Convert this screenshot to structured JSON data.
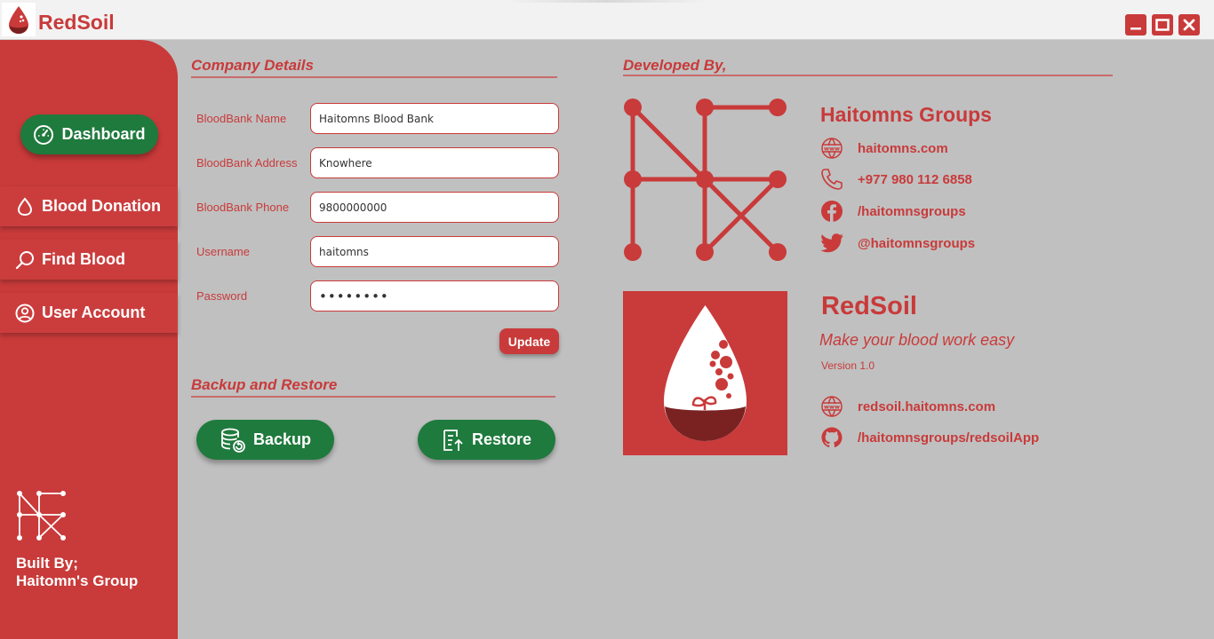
{
  "window": {
    "title": "RedSoil",
    "icon": "blood-drop-icon"
  },
  "sidebar": {
    "dashboard_label": "Dashboard",
    "items": [
      {
        "label": "Blood Donation",
        "icon": "drop-icon"
      },
      {
        "label": "Find Blood",
        "icon": "search-icon"
      },
      {
        "label": "User Account",
        "icon": "user-icon"
      }
    ],
    "built_by_line1": "Built By;",
    "built_by_line2": "Haitomn's Group"
  },
  "company": {
    "title": "Company Details",
    "fields": [
      {
        "label": "BloodBank Name",
        "value": "Haitomns Blood Bank"
      },
      {
        "label": "BloodBank Address",
        "value": "Knowhere"
      },
      {
        "label": "BloodBank Phone",
        "value": "9800000000"
      },
      {
        "label": "Username",
        "value": "haitomns"
      },
      {
        "label": "Password",
        "value": "••••••••"
      }
    ],
    "update_label": "Update"
  },
  "backup": {
    "title": "Backup and Restore",
    "backup_label": "Backup",
    "restore_label": "Restore"
  },
  "developer": {
    "title": "Developed By,",
    "name": "Haitomns Groups",
    "website": "haitomns.com",
    "phone": "+977 980 112 6858",
    "facebook": "/haitomnsgroups",
    "twitter": "@haitomnsgroups"
  },
  "product": {
    "name": "RedSoil",
    "tagline": "Make your blood work easy",
    "version": "Version 1.0",
    "website": "redsoil.haitomns.com",
    "github": "/haitomnsgroups/redsoilApp"
  },
  "colors": {
    "accent": "#c93a3a",
    "green": "#1f7a3d",
    "background": "#c0c0c0"
  }
}
